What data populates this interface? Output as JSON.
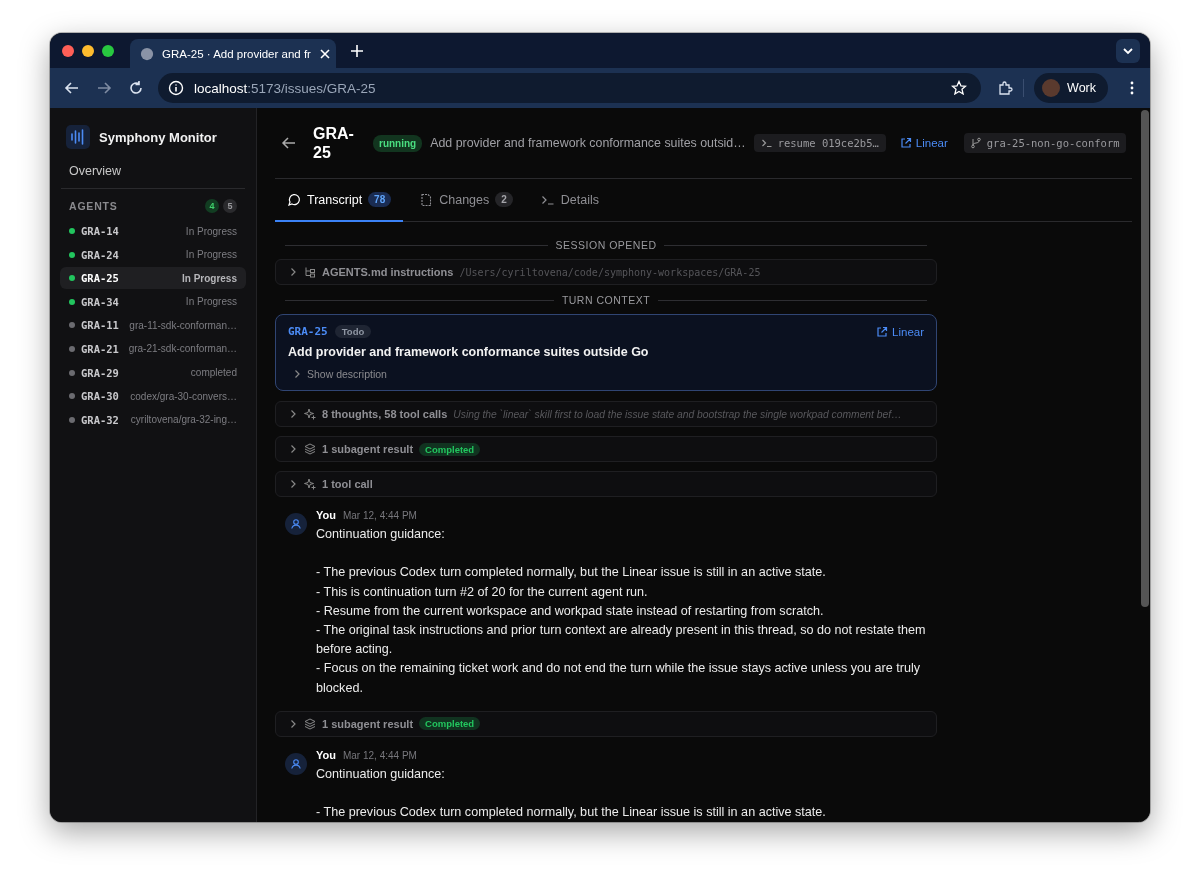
{
  "browser": {
    "tab_title": "GRA-25 · Add provider and fr",
    "url_host": "localhost",
    "url_path": ":5173/issues/GRA-25",
    "profile": "Work"
  },
  "sidebar": {
    "app_name": "Symphony Monitor",
    "nav": [
      {
        "label": "Overview"
      }
    ],
    "section_title": "AGENTS",
    "counts": [
      {
        "count": "4",
        "kind": "running"
      },
      {
        "count": "5",
        "kind": "idle"
      }
    ],
    "agents": [
      {
        "id": "GRA-14",
        "status": "In Progress",
        "color": "#22c55e",
        "selected": false
      },
      {
        "id": "GRA-24",
        "status": "In Progress",
        "color": "#22c55e",
        "selected": false
      },
      {
        "id": "GRA-25",
        "status": "In Progress",
        "color": "#22c55e",
        "selected": true
      },
      {
        "id": "GRA-34",
        "status": "In Progress",
        "color": "#22c55e",
        "selected": false
      },
      {
        "id": "GRA-11",
        "status": "gra-11-sdk-conforman…",
        "color": "#6b6b70",
        "selected": false
      },
      {
        "id": "GRA-21",
        "status": "gra-21-sdk-conforman…",
        "color": "#6b6b70",
        "selected": false
      },
      {
        "id": "GRA-29",
        "status": "completed",
        "color": "#6b6b70",
        "selected": false
      },
      {
        "id": "GRA-30",
        "status": "codex/gra-30-convers…",
        "color": "#6b6b70",
        "selected": false
      },
      {
        "id": "GRA-32",
        "status": "cyriltovena/gra-32-ing…",
        "color": "#6b6b70",
        "selected": false
      }
    ]
  },
  "header": {
    "issue_id": "GRA-25",
    "status": "running",
    "title": "Add provider and framework conformance suites outsid…",
    "resume": "resume 019ce2b5…",
    "link": "Linear",
    "branch": "gra-25-non-go-conform"
  },
  "tabs": [
    {
      "label": "Transcript",
      "count": "78",
      "selected": true
    },
    {
      "label": "Changes",
      "count": "2",
      "selected": false
    },
    {
      "label": "Details",
      "selected": false
    }
  ],
  "transcript": [
    {
      "kind": "divider",
      "label": "SESSION OPENED"
    },
    {
      "kind": "instructions",
      "label": "AGENTS.md instructions",
      "detail": "/Users/cyriltovena/code/symphony-workspaces/GRA-25"
    },
    {
      "kind": "divider",
      "label": "TURN CONTEXT"
    },
    {
      "kind": "issue",
      "issue_id": "GRA-25",
      "state": "Todo",
      "link": "Linear",
      "title": "Add provider and framework conformance suites outside Go",
      "toggle": "Show description"
    },
    {
      "kind": "tool_calls",
      "label": "8 thoughts, 58 tool calls",
      "detail": "Using the `linear` skill first to load the issue state and bootstrap the single workpad comment bef…"
    },
    {
      "kind": "subagent",
      "label": "1 subagent result",
      "badge": "Completed"
    },
    {
      "kind": "tool_calls",
      "label": "1 tool call"
    },
    {
      "kind": "message",
      "author": "You",
      "time": "Mar 12, 4:44 PM",
      "text": "Continuation guidance:\n\n- The previous Codex turn completed normally, but the Linear issue is still in an active state.\n- This is continuation turn #2 of 20 for the current agent run.\n- Resume from the current workspace and workpad state instead of restarting from scratch.\n- The original task instructions and prior turn context are already present in this thread, so do not restate them before acting.\n- Focus on the remaining ticket work and do not end the turn while the issue stays active unless you are truly blocked."
    },
    {
      "kind": "subagent",
      "label": "1 subagent result",
      "badge": "Completed"
    },
    {
      "kind": "message",
      "author": "You",
      "time": "Mar 12, 4:44 PM",
      "text": "Continuation guidance:\n\n- The previous Codex turn completed normally, but the Linear issue is still in an active state."
    }
  ]
}
